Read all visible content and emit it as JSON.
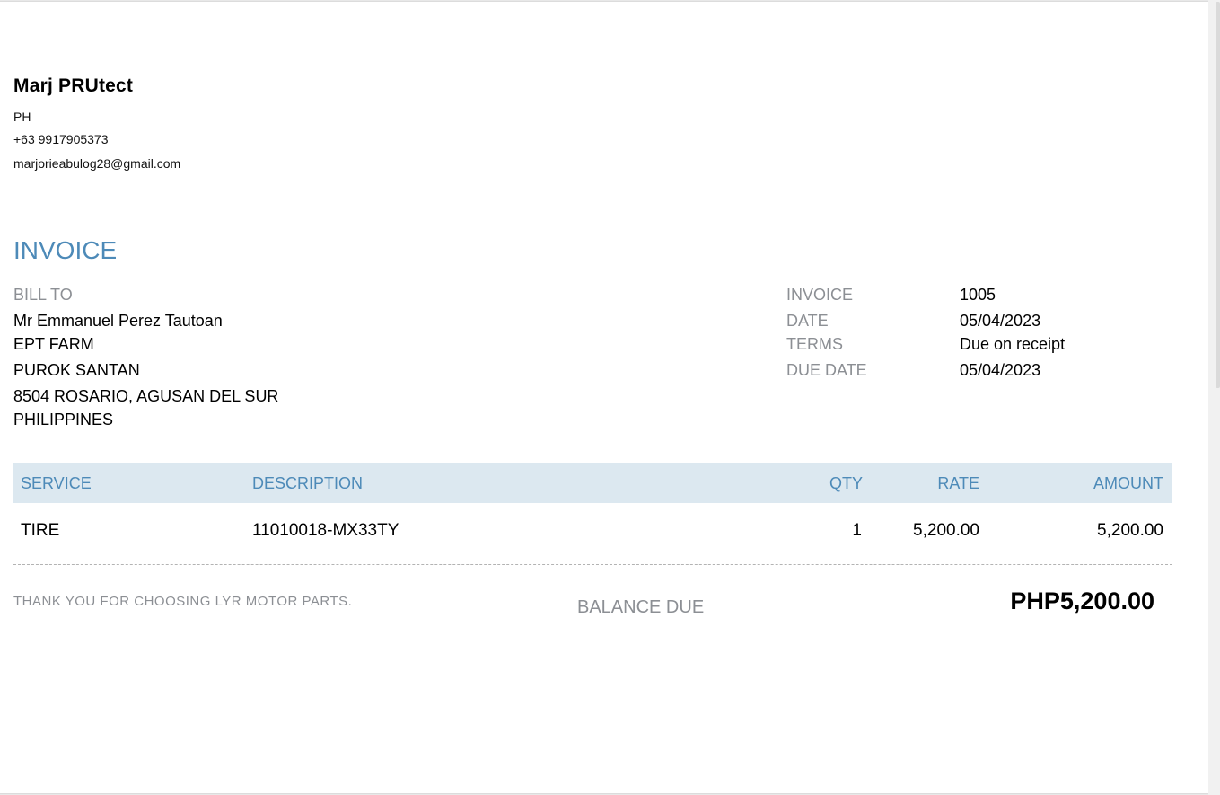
{
  "company": {
    "name": "Marj PRUtect",
    "country": "PH",
    "phone": "+63 9917905373",
    "email": "marjorieabulog28@gmail.com"
  },
  "title": "INVOICE",
  "bill_to": {
    "label": "BILL TO",
    "lines": [
      "Mr Emmanuel Perez Tautoan",
      "EPT FARM",
      "PUROK SANTAN",
      "8504 ROSARIO, AGUSAN DEL SUR",
      "PHILIPPINES"
    ]
  },
  "meta": [
    {
      "label": "INVOICE",
      "value": "1005"
    },
    {
      "label": "DATE",
      "value": "05/04/2023"
    },
    {
      "label": "TERMS",
      "value": "Due on receipt"
    },
    {
      "label": "DUE DATE",
      "value": "05/04/2023"
    }
  ],
  "table": {
    "headers": {
      "service": "SERVICE",
      "description": "DESCRIPTION",
      "qty": "QTY",
      "rate": "RATE",
      "amount": "AMOUNT"
    },
    "rows": [
      {
        "service": "TIRE",
        "description": "11010018-MX33TY",
        "qty": "1",
        "rate": "5,200.00",
        "amount": "5,200.00"
      }
    ]
  },
  "footer": {
    "thanks": "THANK YOU FOR CHOOSING LYR MOTOR PARTS.",
    "balance_label": "BALANCE DUE",
    "balance_amount": "PHP5,200.00"
  },
  "colors": {
    "accent": "#4d8ab8",
    "header_bg": "#dce8f0",
    "muted": "#8c8f94"
  }
}
